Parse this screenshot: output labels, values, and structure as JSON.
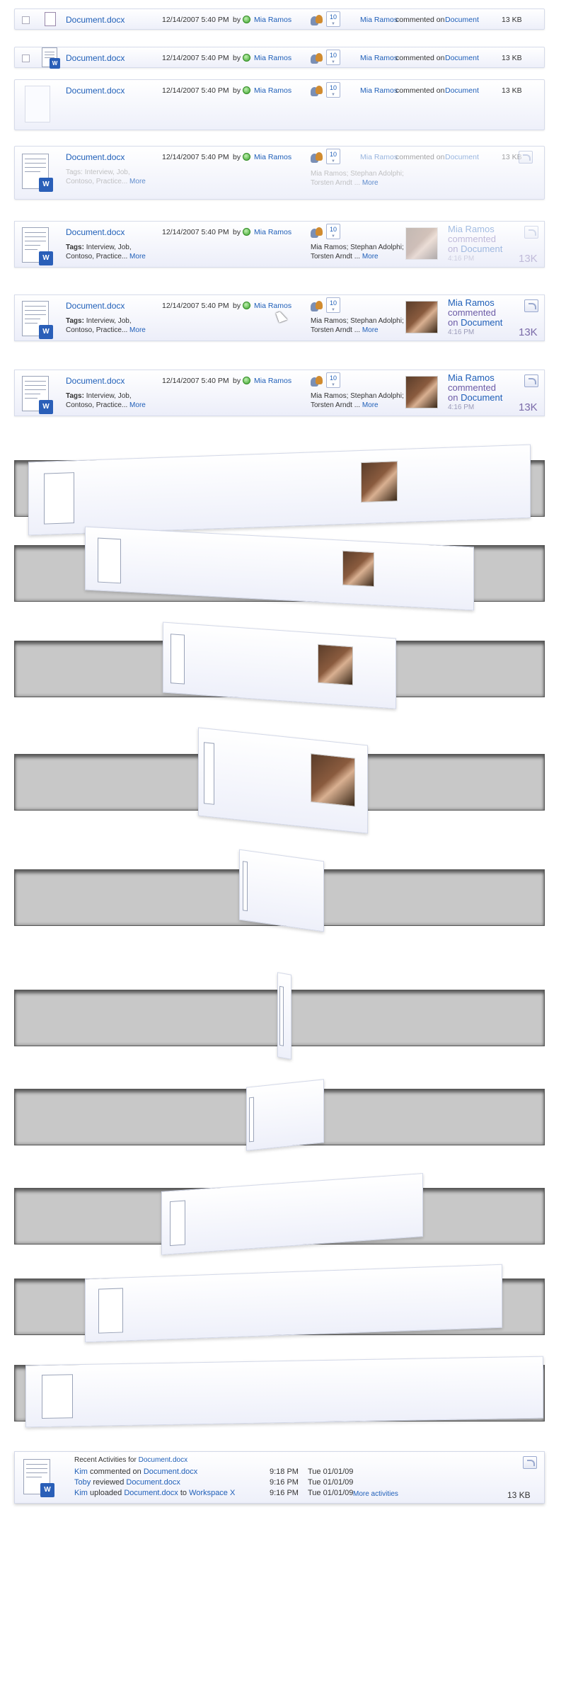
{
  "doc": {
    "name": "Document.docx",
    "datetime": "12/14/2007 5:40 PM",
    "by": "by",
    "author": "Mia Ramos",
    "count": "10",
    "activity_actor": "Mia Ramos",
    "activity_verb": "commented on",
    "activity_object": "Document",
    "size_small": "13 KB",
    "size_big": "13K",
    "tags_label": "Tags:",
    "tags_line1": "Interview, Job,",
    "tags_line2": "Contoso, Practice...",
    "more": "More",
    "tags_inline": "Interview, Job, Contoso, Practice...",
    "people_line1": "Mia Ramos;  Stephan Adolphi;",
    "people_line2": "Torsten Arndt ...",
    "big_name": "Mia Ramos",
    "big_commented": "commented",
    "big_on": "on",
    "big_document": "Document",
    "big_time": "4:16 PM"
  },
  "recent": {
    "title": "Recent Activities for",
    "title_doc": "Document.docx",
    "rows": [
      {
        "actor": "Kim",
        "verb": "commented on",
        "object": "Document.docx",
        "extra_pre": "",
        "extra": "",
        "time": "9:18 PM",
        "date": "Tue 01/01/09"
      },
      {
        "actor": "Toby",
        "verb": "reviewed",
        "object": "Document.docx",
        "extra_pre": "",
        "extra": "",
        "time": "9:16 PM",
        "date": "Tue 01/01/09"
      },
      {
        "actor": "Kim",
        "verb": "uploaded",
        "object": "Document.docx",
        "extra_pre": "to",
        "extra": "Workspace X",
        "time": "9:16 PM",
        "date": "Tue 01/01/09"
      }
    ],
    "more_activities": "More activities",
    "size": "13 KB"
  },
  "icons": {
    "checkbox": "checkbox-icon",
    "document": "document-icon",
    "word": "word-document-icon",
    "presence": "presence-icon",
    "people": "people-icon",
    "expand": "expand-corner-icon",
    "photo": "user-photo"
  },
  "colors": {
    "link": "#1f5fb8",
    "size": "#7a6aa8",
    "presence": "#3ba32b",
    "frame": "#c8c8c8"
  }
}
